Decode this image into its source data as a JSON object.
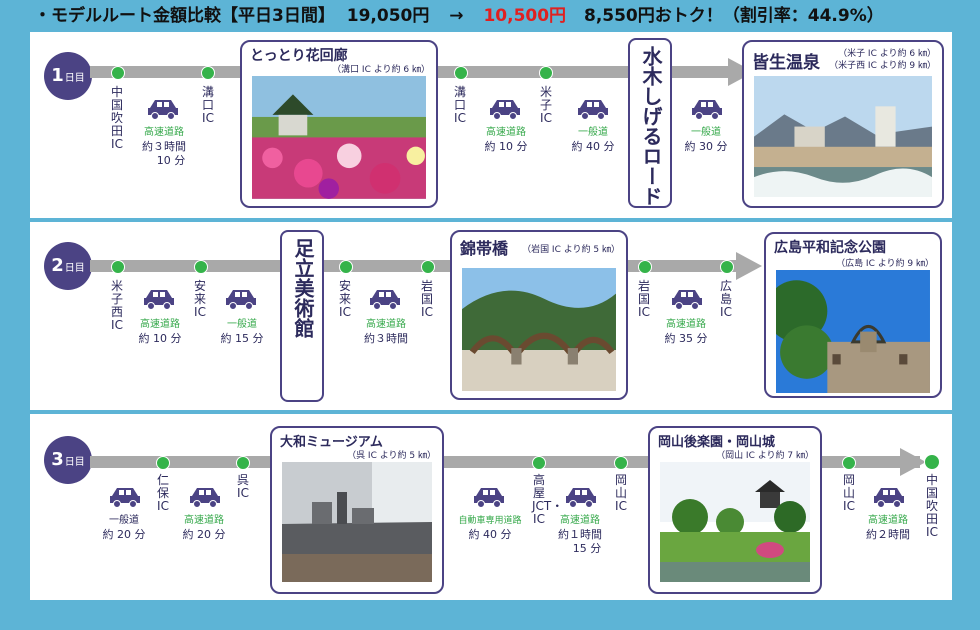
{
  "header": {
    "prefix": "・モデルルート金額比較【平日3日間】",
    "normal_price": "19,050円",
    "arrow": "→",
    "discount_price": "10,500円",
    "savings": "8,550円おトク！（割引率：44.9%）"
  },
  "colors": {
    "accent": "#4b4384",
    "route_dot": "#35b34a",
    "highlight_red": "#e02020",
    "frame": "#5db4d6"
  },
  "days": [
    {
      "num": "1",
      "unit": "日目"
    },
    {
      "num": "2",
      "unit": "日目"
    },
    {
      "num": "3",
      "unit": "日目"
    }
  ],
  "day1": {
    "ic1": "中国吹田IC",
    "leg1": {
      "road": "高速道路",
      "time1": "約３時間",
      "time2": "10 分"
    },
    "ic2": "溝口IC",
    "spot1": {
      "title": "とっとり花回廊",
      "sub": "（溝口 IC より約 6 ㎞）"
    },
    "ic3": "溝口IC",
    "leg2": {
      "road": "高速道路",
      "time": "約 10 分"
    },
    "ic4": "米子IC",
    "leg3": {
      "road": "一般道",
      "time": "約 40 分"
    },
    "spot2": {
      "title": "水木しげるロード"
    },
    "leg4": {
      "road": "一般道",
      "time": "約 30 分"
    },
    "spot3": {
      "title": "皆生温泉",
      "sub1": "（米子 IC より約 6 ㎞）",
      "sub2": "（米子西 IC より約 9 ㎞）"
    }
  },
  "day2": {
    "ic1": "米子西IC",
    "leg1": {
      "road": "高速道路",
      "time": "約 10 分"
    },
    "ic2": "安来IC",
    "leg2": {
      "road": "一般道",
      "time": "約 15 分"
    },
    "spot1": {
      "title": "足立美術館"
    },
    "ic3": "安来IC",
    "leg3": {
      "road": "高速道路",
      "time": "約３時間"
    },
    "ic4": "岩国IC",
    "spot2": {
      "title": "錦帯橋",
      "sub": "（岩国 IC より約 5 ㎞）"
    },
    "ic5": "岩国IC",
    "leg4": {
      "road": "高速道路",
      "time": "約 35 分"
    },
    "ic6": "広島IC",
    "spot3": {
      "title": "広島平和記念公園",
      "sub": "（広島 IC より約 9 ㎞）"
    }
  },
  "day3": {
    "leg1": {
      "road": "一般道",
      "time": "約 20 分"
    },
    "ic1": "仁保IC",
    "leg2": {
      "road": "高速道路",
      "time": "約 20 分"
    },
    "ic2": "呉IC",
    "spot1": {
      "title": "大和ミュージアム",
      "sub": "（呉 IC より約 5 ㎞）"
    },
    "leg3": {
      "road": "自動車専用道路",
      "time": "約 40 分"
    },
    "ic3": "高屋JCT・IC",
    "leg4": {
      "road": "高速道路",
      "time1": "約１時間",
      "time2": "15 分"
    },
    "ic4": "岡山IC",
    "spot2": {
      "title": "岡山後楽園・岡山城",
      "sub": "（岡山 IC より約 7 ㎞）"
    },
    "ic5": "岡山IC",
    "leg5": {
      "road": "高速道路",
      "time": "約２時間"
    },
    "ic6": "中国吹田IC"
  }
}
